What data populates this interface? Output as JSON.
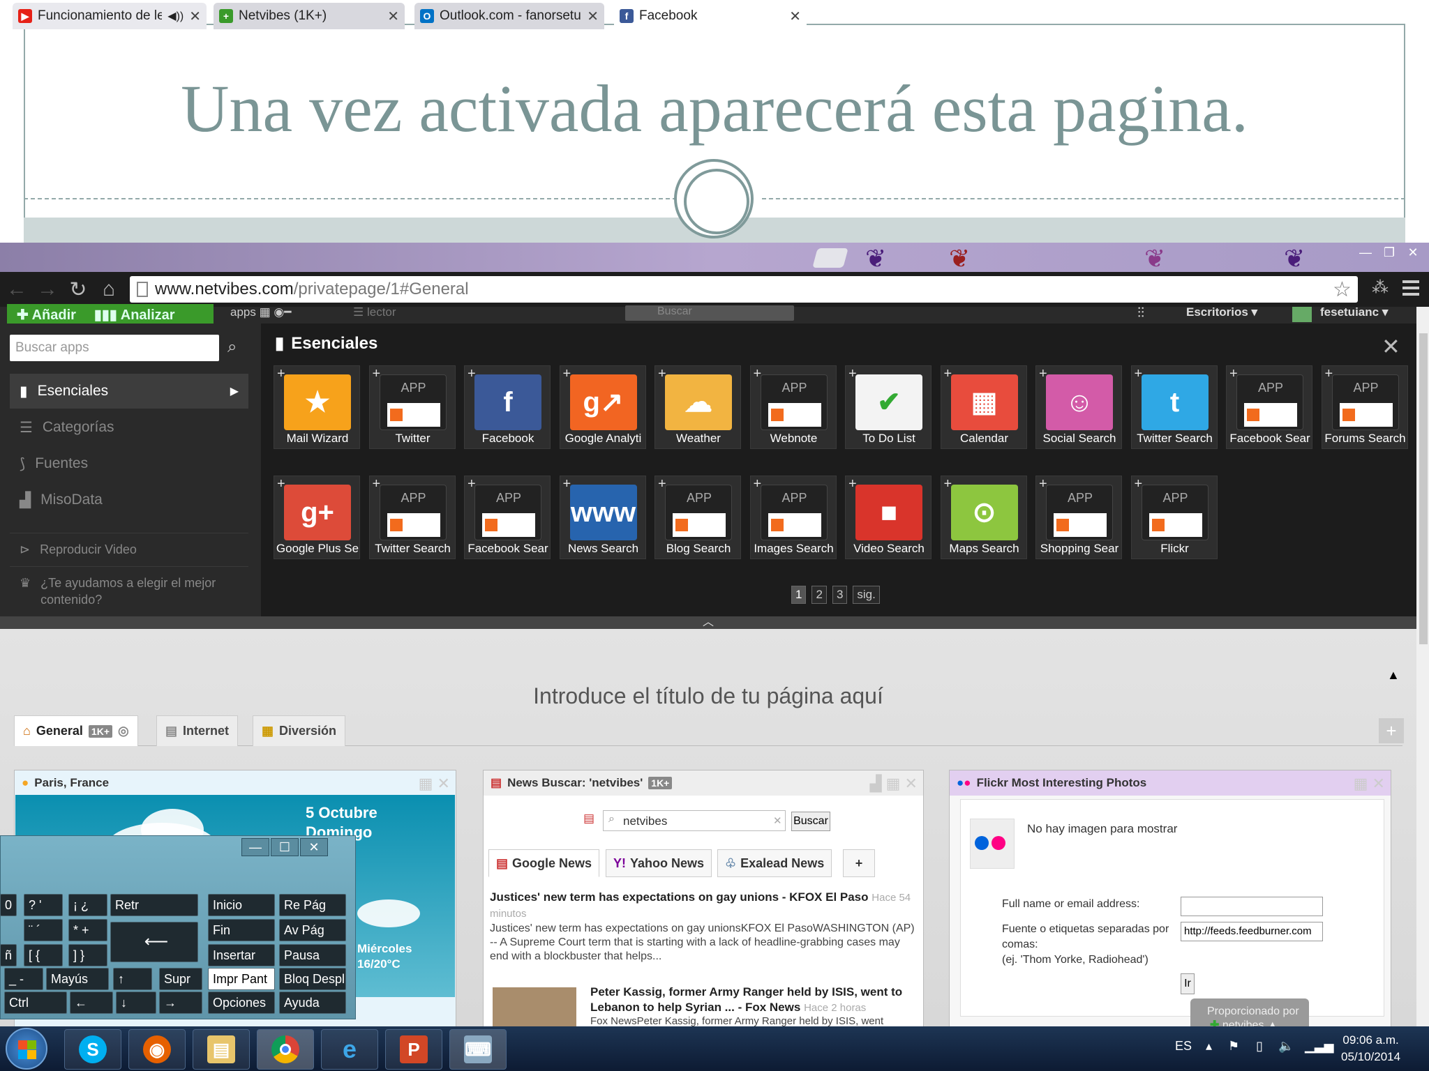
{
  "slide": {
    "title": "Una vez activada aparecerá esta pagina."
  },
  "browser": {
    "tabs": [
      {
        "label": "Funcionamiento de lec",
        "icon": "youtube-icon",
        "color": "#e62117"
      },
      {
        "label": "Netvibes (1K+)",
        "icon": "netvibes-icon",
        "color": "#3a9a2a"
      },
      {
        "label": "Outlook.com - fanorsetua",
        "icon": "outlook-icon",
        "color": "#0072c6"
      },
      {
        "label": "Facebook",
        "icon": "facebook-icon",
        "color": "#3b5998"
      }
    ],
    "url_domain": "www.netvibes.com",
    "url_path": "/privatepage/1#General"
  },
  "netvibes": {
    "add_label": "Añadir",
    "analyze_label": "Analizar",
    "apps_label": "apps",
    "lector_label": "lector",
    "search_placeholder": "Buscar",
    "escritorios_label": "Escritorios",
    "user_label": "fesetuianc",
    "sidebar": {
      "search_placeholder": "Buscar apps",
      "items": [
        "Esenciales",
        "Categorías",
        "Fuentes",
        "MisoData"
      ],
      "play_video": "Reproducir Video",
      "help_line1": "¿Te ayudamos a elegir el mejor",
      "help_line2": "contenido?"
    },
    "panel_title": "Esenciales",
    "app_placeholder": "APP",
    "apps_row1": [
      "Mail Wizard",
      "Twitter",
      "Facebook",
      "Google Analyti",
      "Weather",
      "Webnote",
      "To Do List",
      "Calendar",
      "Social Search",
      "Twitter Search",
      "Facebook Sear",
      "Forums Search"
    ],
    "apps_row2": [
      "Google Plus Se",
      "Twitter Search",
      "Facebook Sear",
      "News Search",
      "Blog Search",
      "Images Search",
      "Video Search",
      "Maps Search",
      "Shopping Sear",
      "Flickr"
    ],
    "pager": [
      "1",
      "2",
      "3",
      "sig."
    ]
  },
  "page": {
    "title": "Introduce el título de tu página aquí",
    "tabs": [
      {
        "label": "General",
        "badge": "1K+"
      },
      {
        "label": "Internet"
      },
      {
        "label": "Diversión"
      }
    ]
  },
  "weather": {
    "title": "Paris, France",
    "date_line1": "5 Octubre",
    "date_line2": "Domingo",
    "day": "Miércoles",
    "temp": "16/20°C"
  },
  "news": {
    "title": "News Buscar: 'netvibes'",
    "badge": "1K+",
    "query": "netvibes",
    "search_button": "Buscar",
    "sources": [
      "Google News",
      "Yahoo News",
      "Exalead News"
    ],
    "add_tab": "+",
    "item1_title": "Justices' new term has expectations on gay unions - KFOX El Paso",
    "item1_ago": "Hace 54 minutos",
    "item1_body": "Justices' new term has expectations on gay unionsKFOX El PasoWASHINGTON (AP) -- A Supreme Court term that is starting with a lack of headline-grabbing cases may end with a blockbuster that helps...",
    "item2_title": "Peter Kassig, former Army Ranger held by ISIS, went to Lebanon to help Syrian ... - Fox News",
    "item2_ago": "Hace 2 horas",
    "item2_body": "Fox NewsPeter Kassig, former Army Ranger held by ISIS, went"
  },
  "flickr": {
    "title": "Flickr Most Interesting Photos",
    "no_image": "No hay imagen para mostrar",
    "name_label": "Full name or email address:",
    "source_label1": "Fuente o etiquetas separadas por",
    "source_label2": "comas:",
    "source_example": "(ej. 'Thom Yorke, Radiohead')",
    "source_value": "http://feeds.feedburner.com",
    "go_button": "Ir",
    "powered_by": "Proporcionado por",
    "powered_brand": "netvibes"
  },
  "keyboard": {
    "keys": [
      {
        "label": "0",
        "row": 0,
        "col": "k0"
      },
      {
        "label": "?  '",
        "row": 0,
        "col": "k1"
      },
      {
        "label": "¡  ¿",
        "row": 0,
        "col": "k2"
      },
      {
        "label": "Retr",
        "row": 0,
        "col": "k3"
      },
      {
        "label": "Inicio",
        "row": 0,
        "col": "n1"
      },
      {
        "label": "Re Pág",
        "row": 0,
        "col": "n2"
      },
      {
        "label": "¨  ´",
        "row": 1,
        "col": "k1"
      },
      {
        "label": "*  +",
        "row": 1,
        "col": "k2"
      },
      {
        "label": "Fin",
        "row": 1,
        "col": "n1"
      },
      {
        "label": "Av Pág",
        "row": 1,
        "col": "n2"
      },
      {
        "label": "ñ",
        "row": 2,
        "col": "k0"
      },
      {
        "label": "[  {",
        "row": 2,
        "col": "k1"
      },
      {
        "label": "]  }",
        "row": 2,
        "col": "k2"
      },
      {
        "label": "Insertar",
        "row": 2,
        "col": "n1"
      },
      {
        "label": "Pausa",
        "row": 2,
        "col": "n2"
      },
      {
        "label": "_  -",
        "row": 3,
        "col": "k1"
      },
      {
        "label": "Mayús",
        "row": 3,
        "col": "k2"
      },
      {
        "label": "↑",
        "row": 3,
        "col": "k3"
      },
      {
        "label": "Supr",
        "row": 3,
        "col": "k4"
      },
      {
        "label": "Impr Pant",
        "row": 3,
        "col": "n1"
      },
      {
        "label": "Bloq Despl",
        "row": 3,
        "col": "n2"
      },
      {
        "label": "Ctrl",
        "row": 4,
        "col": "k0"
      },
      {
        "label": "←",
        "row": 4,
        "col": "k2"
      },
      {
        "label": "↓",
        "row": 4,
        "col": "k3"
      },
      {
        "label": "→",
        "row": 4,
        "col": "k4"
      },
      {
        "label": "Opciones",
        "row": 4,
        "col": "n1"
      },
      {
        "label": "Ayuda",
        "row": 4,
        "col": "n2"
      }
    ],
    "enter_symbol": "⟵",
    "active_key": "Impr Pant"
  },
  "taskbar": {
    "apps": [
      "skype-icon",
      "firefox-icon",
      "explorer-icon",
      "chrome-icon",
      "ie-icon",
      "powerpoint-icon",
      "keyboard-icon"
    ],
    "lang": "ES",
    "time": "09:06 a.m.",
    "date": "05/10/2014"
  }
}
